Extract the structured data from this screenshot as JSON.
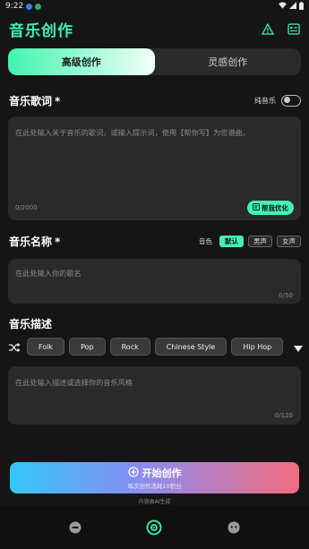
{
  "status": {
    "time": "9:22"
  },
  "header": {
    "title": "音乐创作"
  },
  "tabs": [
    {
      "label": "高级创作",
      "active": true
    },
    {
      "label": "灵感创作",
      "active": false
    }
  ],
  "lyrics": {
    "title": "音乐歌词",
    "required_mark": "*",
    "pure_music_label": "纯音乐",
    "placeholder": "在此处输入关于音乐的歌词，或输入提示词，使用【帮你写】为您谱曲。",
    "counter": "0/2000",
    "help_label": "帮我优化"
  },
  "name": {
    "title": "音乐名称",
    "required_mark": "*",
    "voice_label": "音色",
    "voice_options": [
      "默认",
      "男声",
      "女声"
    ],
    "voice_selected": "默认",
    "placeholder": "在此处输入你的歌名",
    "counter": "0/50"
  },
  "description": {
    "title": "音乐描述",
    "styles": [
      "Folk",
      "Pop",
      "Rock",
      "Chinese Style",
      "Hip Hop"
    ],
    "placeholder": "在此处输入描述或选择你的音乐风格",
    "counter": "0/120"
  },
  "create": {
    "label": "开始创作",
    "sub": "每次创作消耗10积分"
  },
  "ai_note": "内容由AI生成",
  "colors": {
    "accent": "#3ff5b0",
    "title": "#3ff2b1",
    "background": "#151515"
  }
}
